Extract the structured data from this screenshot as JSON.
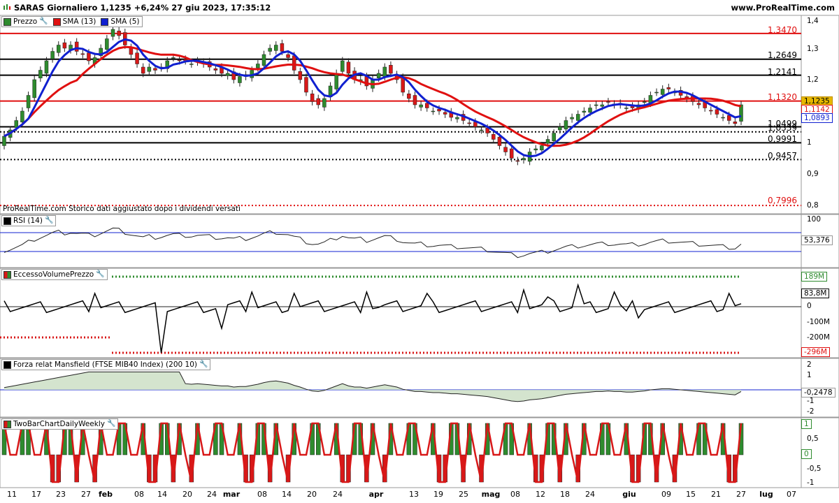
{
  "header": {
    "title": "SARAS Giornaliero 1,1235 +6,24% 27 giu 2023, 17:35:12",
    "site": "www.ProRealTime.com"
  },
  "price_panel": {
    "legend": [
      {
        "label": "Prezzo",
        "color": "#2e8b2e",
        "icon": "wrench-icon"
      },
      {
        "label": "SMA (13)",
        "color": "#e01010"
      },
      {
        "label": "SMA (5)",
        "color": "#1020d0"
      }
    ],
    "levels": [
      {
        "value": 1.347,
        "label": "1,3470",
        "color": "#e01010",
        "style": "solid"
      },
      {
        "value": 1.2649,
        "label": "1,2649",
        "color": "#000000",
        "style": "solid"
      },
      {
        "value": 1.2141,
        "label": "1,2141",
        "color": "#000000",
        "style": "solid"
      },
      {
        "value": 1.132,
        "label": "1,1320",
        "color": "#e01010",
        "style": "solid"
      },
      {
        "value": 1.0499,
        "label": "1,0499",
        "color": "#000000",
        "style": "solid"
      },
      {
        "value": 1.0339,
        "label": "1,0339",
        "color": "#000000",
        "style": "dotted"
      },
      {
        "value": 0.9991,
        "label": "0,9991",
        "color": "#000000",
        "style": "solid"
      },
      {
        "value": 0.9457,
        "label": "0,9457",
        "color": "#000000",
        "style": "dotted"
      },
      {
        "value": 0.7996,
        "label": "0,7996",
        "color": "#e01010",
        "style": "dotted"
      }
    ],
    "axis_ticks": [
      "1,4",
      "1,3",
      "1,2",
      "1,1",
      "1",
      "0,9",
      "0,8"
    ],
    "tags": [
      {
        "label": "1,1235",
        "bg": "#e6b800",
        "fg": "#000000"
      },
      {
        "label": "1,1142",
        "bg": "#ffffff",
        "fg": "#e01010"
      },
      {
        "label": "1,0893",
        "bg": "#ffffff",
        "fg": "#1020d0"
      }
    ],
    "note": "ProRealTime.com Storico dati aggiustato dopo i dividendi versati"
  },
  "rsi_panel": {
    "label": "RSI (14)",
    "axis_ticks": [
      "100"
    ],
    "value_tag": "53,376"
  },
  "volume_panel": {
    "label": "EccessoVolumePrezzo",
    "axis_ticks": [
      "0",
      "-100M",
      "-200M"
    ],
    "tags": [
      {
        "label": "189M",
        "color": "#2e8b2e"
      },
      {
        "label": "83,8M",
        "color": "#000000"
      },
      {
        "label": "0",
        "color": "#000000"
      },
      {
        "label": "-296M",
        "color": "#e01010"
      }
    ]
  },
  "mansfield_panel": {
    "label": "Forza relat Mansfield (FTSE MIB40 Index) (200 10)",
    "axis_ticks": [
      "2",
      "1",
      "0",
      "-1",
      "-2"
    ],
    "value_tag": "-0,2478"
  },
  "twobar_panel": {
    "label": "TwoBarChartDailyWeekly",
    "axis_ticks": [
      "0,5",
      "-0,5",
      "-1"
    ],
    "tags": [
      {
        "label": "1",
        "color": "#2e8b2e"
      },
      {
        "label": "0",
        "color": "#2e8b2e"
      }
    ]
  },
  "x_axis": [
    {
      "label": "11",
      "bold": false
    },
    {
      "label": "17",
      "bold": false
    },
    {
      "label": "23",
      "bold": false
    },
    {
      "label": "27",
      "bold": false
    },
    {
      "label": "feb",
      "bold": true
    },
    {
      "label": "08",
      "bold": false
    },
    {
      "label": "14",
      "bold": false
    },
    {
      "label": "20",
      "bold": false
    },
    {
      "label": "24",
      "bold": false
    },
    {
      "label": "mar",
      "bold": true
    },
    {
      "label": "08",
      "bold": false
    },
    {
      "label": "14",
      "bold": false
    },
    {
      "label": "20",
      "bold": false
    },
    {
      "label": "24",
      "bold": false
    },
    {
      "label": "apr",
      "bold": true
    },
    {
      "label": "13",
      "bold": false
    },
    {
      "label": "19",
      "bold": false
    },
    {
      "label": "25",
      "bold": false
    },
    {
      "label": "mag",
      "bold": true
    },
    {
      "label": "08",
      "bold": false
    },
    {
      "label": "12",
      "bold": false
    },
    {
      "label": "18",
      "bold": false
    },
    {
      "label": "24",
      "bold": false
    },
    {
      "label": "giu",
      "bold": true
    },
    {
      "label": "09",
      "bold": false
    },
    {
      "label": "15",
      "bold": false
    },
    {
      "label": "21",
      "bold": false
    },
    {
      "label": "27",
      "bold": false
    },
    {
      "label": "lug",
      "bold": true
    },
    {
      "label": "07",
      "bold": false
    }
  ],
  "colors": {
    "up": "#2e8b2e",
    "down": "#d81818",
    "sma13": "#e01010",
    "sma5": "#1020d0"
  },
  "chart_data": {
    "type": "candlestick",
    "close_series": [
      1.02,
      1.04,
      1.07,
      1.1,
      1.15,
      1.2,
      1.23,
      1.26,
      1.29,
      1.31,
      1.3,
      1.31,
      1.29,
      1.28,
      1.26,
      1.27,
      1.3,
      1.33,
      1.36,
      1.34,
      1.31,
      1.28,
      1.25,
      1.22,
      1.24,
      1.23,
      1.24,
      1.26,
      1.27,
      1.26,
      1.26,
      1.25,
      1.26,
      1.25,
      1.24,
      1.23,
      1.22,
      1.22,
      1.2,
      1.21,
      1.21,
      1.23,
      1.25,
      1.28,
      1.3,
      1.31,
      1.29,
      1.27,
      1.23,
      1.2,
      1.16,
      1.13,
      1.12,
      1.14,
      1.18,
      1.22,
      1.26,
      1.22,
      1.2,
      1.2,
      1.18,
      1.2,
      1.22,
      1.24,
      1.22,
      1.2,
      1.16,
      1.14,
      1.12,
      1.12,
      1.11,
      1.1,
      1.1,
      1.09,
      1.08,
      1.08,
      1.07,
      1.06,
      1.05,
      1.04,
      1.03,
      1.01,
      0.99,
      0.97,
      0.95,
      0.94,
      0.95,
      0.97,
      0.98,
      0.99,
      1.01,
      1.03,
      1.05,
      1.07,
      1.08,
      1.09,
      1.1,
      1.11,
      1.12,
      1.12,
      1.13,
      1.12,
      1.12,
      1.11,
      1.11,
      1.12,
      1.13,
      1.15,
      1.16,
      1.17,
      1.17,
      1.16,
      1.15,
      1.14,
      1.13,
      1.12,
      1.11,
      1.1,
      1.09,
      1.08,
      1.07,
      1.06,
      1.12
    ]
  }
}
